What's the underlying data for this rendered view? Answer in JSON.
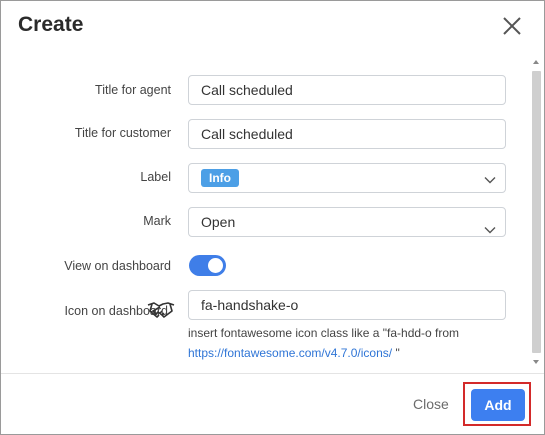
{
  "dialog": {
    "title": "Create"
  },
  "form": {
    "title_agent": {
      "label": "Title for agent",
      "value": "Call scheduled"
    },
    "title_customer": {
      "label": "Title for customer",
      "value": "Call scheduled"
    },
    "label_field": {
      "label": "Label",
      "selected": "Info"
    },
    "mark_field": {
      "label": "Mark",
      "selected": "Open"
    },
    "view_dashboard": {
      "label": "View on dashboard",
      "enabled": true
    },
    "icon_dashboard": {
      "label": "Icon on dashboard",
      "value": "fa-handshake-o",
      "help_text": "insert fontawesome icon class like a \"fa-hdd-o from",
      "help_link": "https://fontawesome.com/v4.7.0/icons/",
      "help_suffix": " \""
    }
  },
  "footer": {
    "close_label": "Close",
    "add_label": "Add"
  },
  "colors": {
    "accent": "#3d7ff0",
    "badge": "#4c9fe6",
    "highlight": "#d32a2a"
  }
}
